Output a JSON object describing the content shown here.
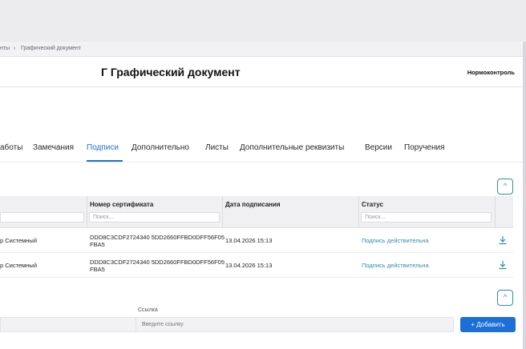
{
  "breadcrumb": {
    "parent": "нты",
    "separator": "›",
    "current": "Графический документ"
  },
  "header": {
    "title": "Г Графический документ",
    "right_label": "Нормоконтроль"
  },
  "tabs": [
    {
      "label": "аботы"
    },
    {
      "label": "Замечания"
    },
    {
      "label": "Подписи",
      "active": true
    },
    {
      "label": "Дополнительно"
    },
    {
      "label": "Листы"
    },
    {
      "label": "Дополнительные реквизиты"
    },
    {
      "label": "Версии"
    },
    {
      "label": "Поручения"
    }
  ],
  "table": {
    "columns": [
      "",
      "Номер сертификата",
      "Дата подписания",
      "Статус"
    ],
    "filter_placeholder": "Поиск...",
    "filter_placeholder_short": "Поиск",
    "rows": [
      {
        "signer": "р Системный",
        "certificate": "DDD8C3CDF2724340 5DD2660FFBD0DFF56F05FBA5",
        "date": "13.04.2026 15:13",
        "status": "Подпись действительна"
      },
      {
        "signer": "р Системный",
        "certificate": "DDD8C3CDF2724340 5DD2660FFBD0DFF56F05FBA5",
        "date": "13.04.2026 15:13",
        "status": "Подпись действительна"
      }
    ]
  },
  "link_section": {
    "label": "Ссылка",
    "placeholder": "Введите ссылку"
  },
  "add_button": {
    "icon": "+",
    "label": "Добавить"
  },
  "collapse_icon": "^",
  "colors": {
    "accent": "#1a73c9",
    "status": "#2e8fa8",
    "primary_button": "#1c6fd6"
  }
}
